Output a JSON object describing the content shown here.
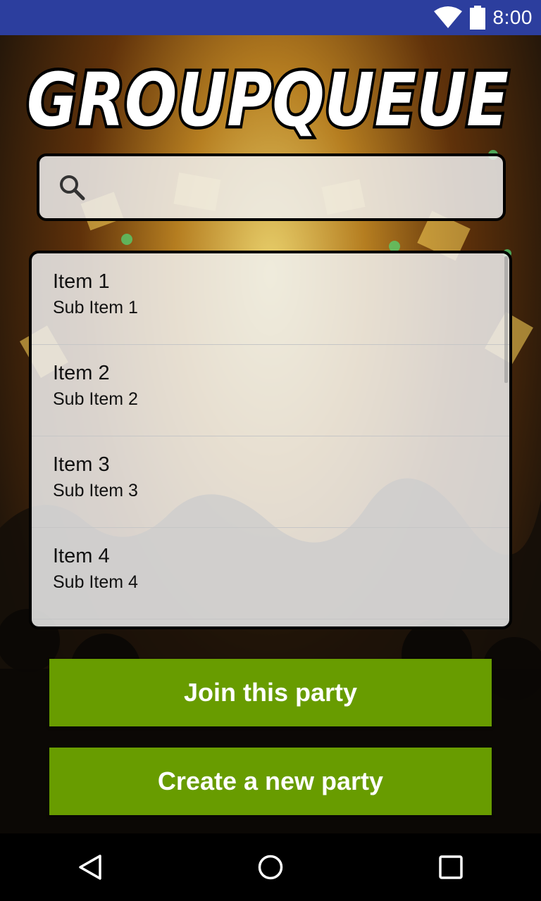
{
  "status_bar": {
    "time": "8:00",
    "wifi_icon": "wifi-icon",
    "battery_icon": "battery-icon"
  },
  "app": {
    "logo_text": "GROUPQUEUE"
  },
  "search": {
    "icon": "search-icon",
    "value": "",
    "placeholder": ""
  },
  "list": {
    "items": [
      {
        "title": "Item 1",
        "subtitle": "Sub Item 1"
      },
      {
        "title": "Item 2",
        "subtitle": "Sub Item 2"
      },
      {
        "title": "Item 3",
        "subtitle": "Sub Item 3"
      },
      {
        "title": "Item 4",
        "subtitle": "Sub Item 4"
      }
    ]
  },
  "buttons": {
    "join_label": "Join this party",
    "create_label": "Create a new party",
    "color": "#689c00"
  },
  "nav_bar": {
    "back_icon": "back-triangle-icon",
    "home_icon": "home-circle-icon",
    "recents_icon": "recents-square-icon"
  }
}
